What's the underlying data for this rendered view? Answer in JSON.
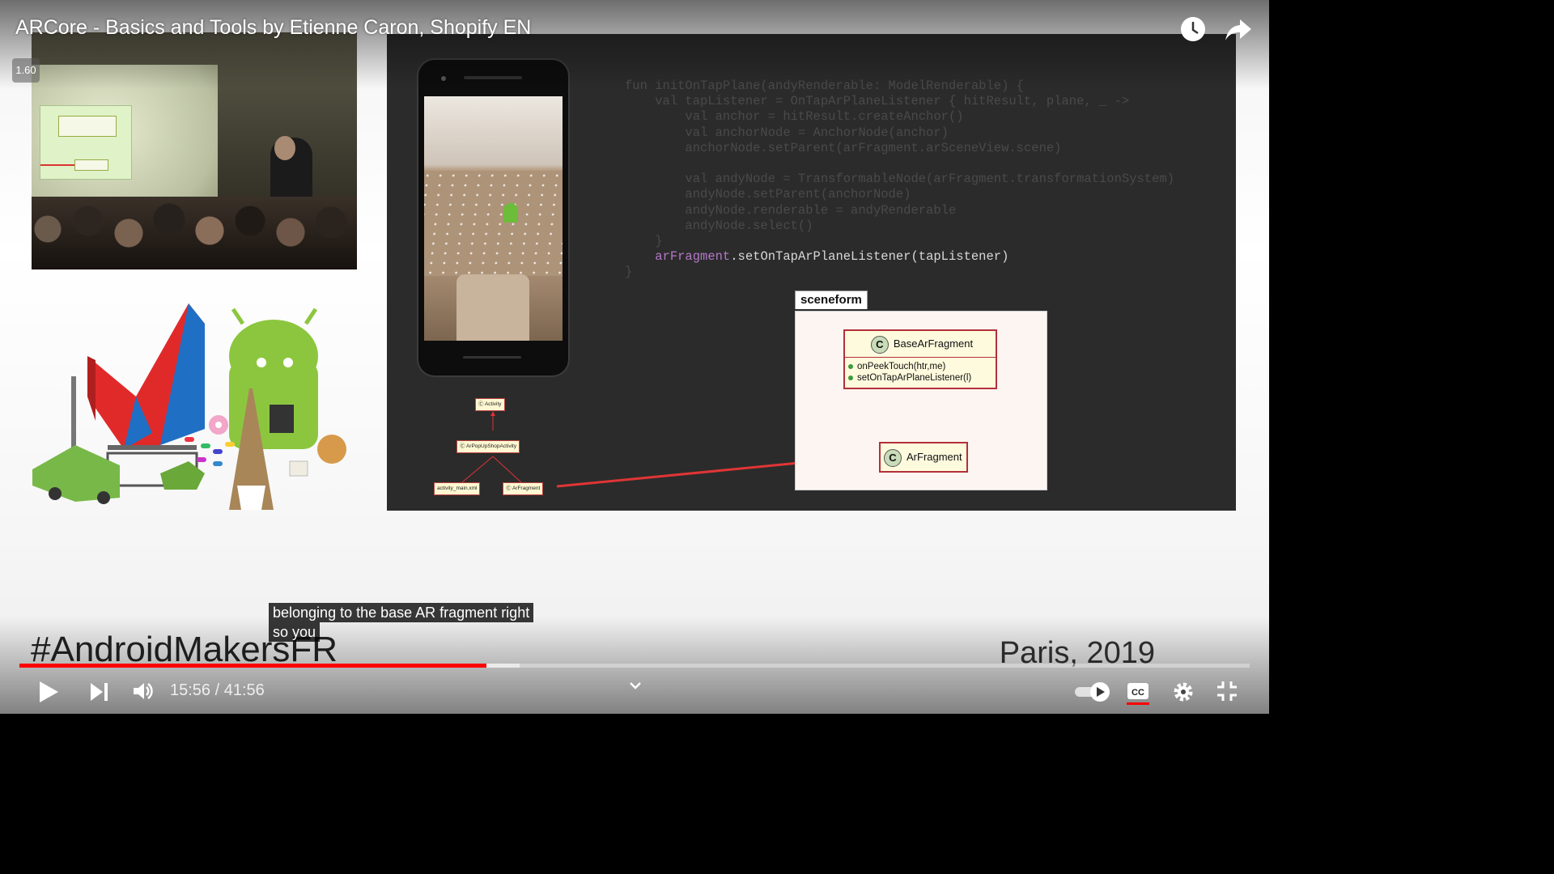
{
  "video": {
    "title": "ARCore - Basics and Tools by Etienne Caron, Shopify EN",
    "speed_badge": "1.60",
    "caption_lines": [
      "belonging to the base AR fragment right",
      "so you"
    ]
  },
  "slide": {
    "code_lines": [
      "fun initOnTapPlane(andyRenderable: ModelRenderable) {",
      "    val tapListener = OnTapArPlaneListener { hitResult, plane, _ ->",
      "        val anchor = hitResult.createAnchor()",
      "        val anchorNode = AnchorNode(anchor)",
      "        anchorNode.setParent(arFragment.arSceneView.scene)",
      "",
      "        val andyNode = TransformableNode(arFragment.transformationSystem)",
      "        andyNode.setParent(anchorNode)",
      "        andyNode.renderable = andyRenderable",
      "        andyNode.select()",
      "    }",
      "    arFragment.setOnTapArPlaneListener(tapListener)",
      "}"
    ],
    "highlight_line_object": "arFragment",
    "highlight_line_rest": ".setOnTapArPlaneListener(tapListener)",
    "uml_package": "sceneform",
    "uml_base_class": "BaseArFragment",
    "uml_methods": [
      "onPeekTouch(htr,me)",
      "setOnTapArPlaneListener(l)"
    ],
    "uml_sub_class": "ArFragment",
    "class_badge": "C",
    "mini_diagram": {
      "activity": "Activity",
      "shop_activity": "ArPopUpShopActivity",
      "layout": "activity_main.xml",
      "fragment": "ArFragment"
    },
    "hashtag": "#AndroidMakersFR",
    "place": "Paris, 2019"
  },
  "controls": {
    "current_time": "15:56",
    "separator": " / ",
    "duration": "41:56",
    "progress_played_fraction": 0.3798,
    "progress_buffered_fraction": 0.4065,
    "autoplay_on": true,
    "captions_on": true
  },
  "icons": {
    "watch_later": "clock-icon",
    "share": "share-arrow-icon",
    "play": "play-icon",
    "next": "skip-next-icon",
    "volume": "volume-icon",
    "chevron": "chevron-down-icon",
    "autoplay": "autoplay-toggle-icon",
    "captions": "cc-icon",
    "settings": "gear-icon",
    "fullscreen_exit": "exit-fullscreen-icon"
  },
  "colors": {
    "progress_played": "#ff0000",
    "caption_bg": "#080808",
    "uml_border": "#b3303a"
  }
}
